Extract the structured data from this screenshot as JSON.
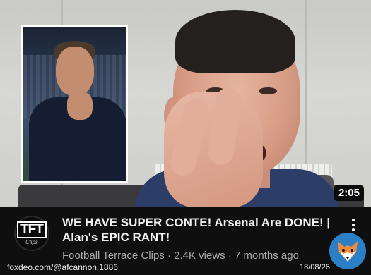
{
  "video": {
    "duration": "2:05",
    "title": "WE HAVE SUPER CONTE! Arsenal Are DONE! | Alan's EPIC RANT!",
    "channel": "Football Terrace Clips",
    "views": "2.4K views",
    "age": "7 months ago",
    "separator": " · "
  },
  "channel_avatar": {
    "logo_text": "TFT",
    "sub_text": "Clips"
  },
  "watermark": {
    "handle": "foxdeo.com/@afcannon.1886",
    "date": "18/08/26",
    "fox_icon": "fox-logo-icon"
  },
  "colors": {
    "background": "#0f0f0f",
    "meta_text": "#aaaaaa",
    "fox_badge": "#2b7fc6"
  }
}
